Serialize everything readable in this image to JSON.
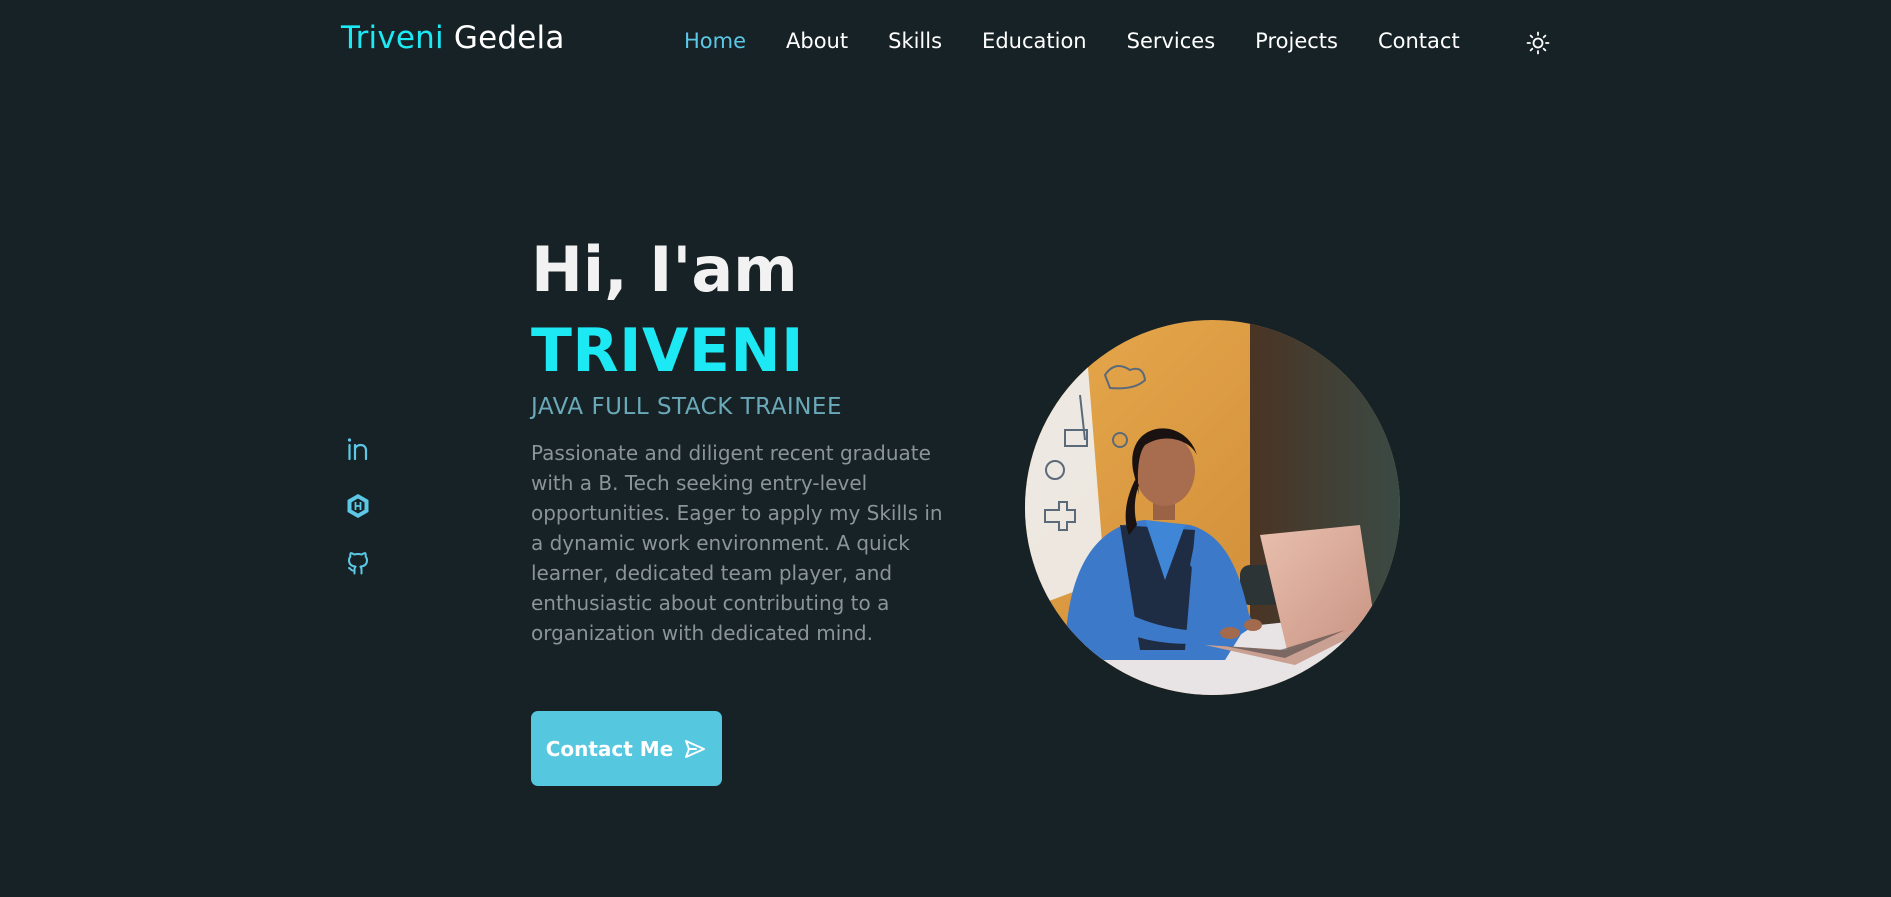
{
  "header": {
    "logo_first": "Triveni",
    "logo_last": "Gedela",
    "nav": [
      {
        "label": "Home",
        "active": true
      },
      {
        "label": "About",
        "active": false
      },
      {
        "label": "Skills",
        "active": false
      },
      {
        "label": "Education",
        "active": false
      },
      {
        "label": "Services",
        "active": false
      },
      {
        "label": "Projects",
        "active": false
      },
      {
        "label": "Contact",
        "active": false
      }
    ],
    "theme_toggle_icon": "sun-icon"
  },
  "socials": [
    {
      "icon": "linkedin-icon"
    },
    {
      "icon": "hashnode-icon"
    },
    {
      "icon": "github-icon"
    }
  ],
  "hero": {
    "greeting": "Hi, I'am",
    "name": "TRIVENI",
    "role": "JAVA FULL STACK TRAINEE",
    "bio": "Passionate and diligent recent graduate with a B. Tech seeking entry-level opportunities. Eager to apply my Skills in a dynamic work environment. A quick learner, dedicated team player, and enthusiastic about contributing to a organization with dedicated mind.",
    "cta_label": "Contact Me",
    "cta_icon": "send-icon"
  },
  "colors": {
    "background": "#172226",
    "accent": "#1de9f4",
    "nav_active": "#5cc8e6",
    "button": "#55c7df",
    "role": "#6aa9b8",
    "body_text": "#8b9498"
  }
}
